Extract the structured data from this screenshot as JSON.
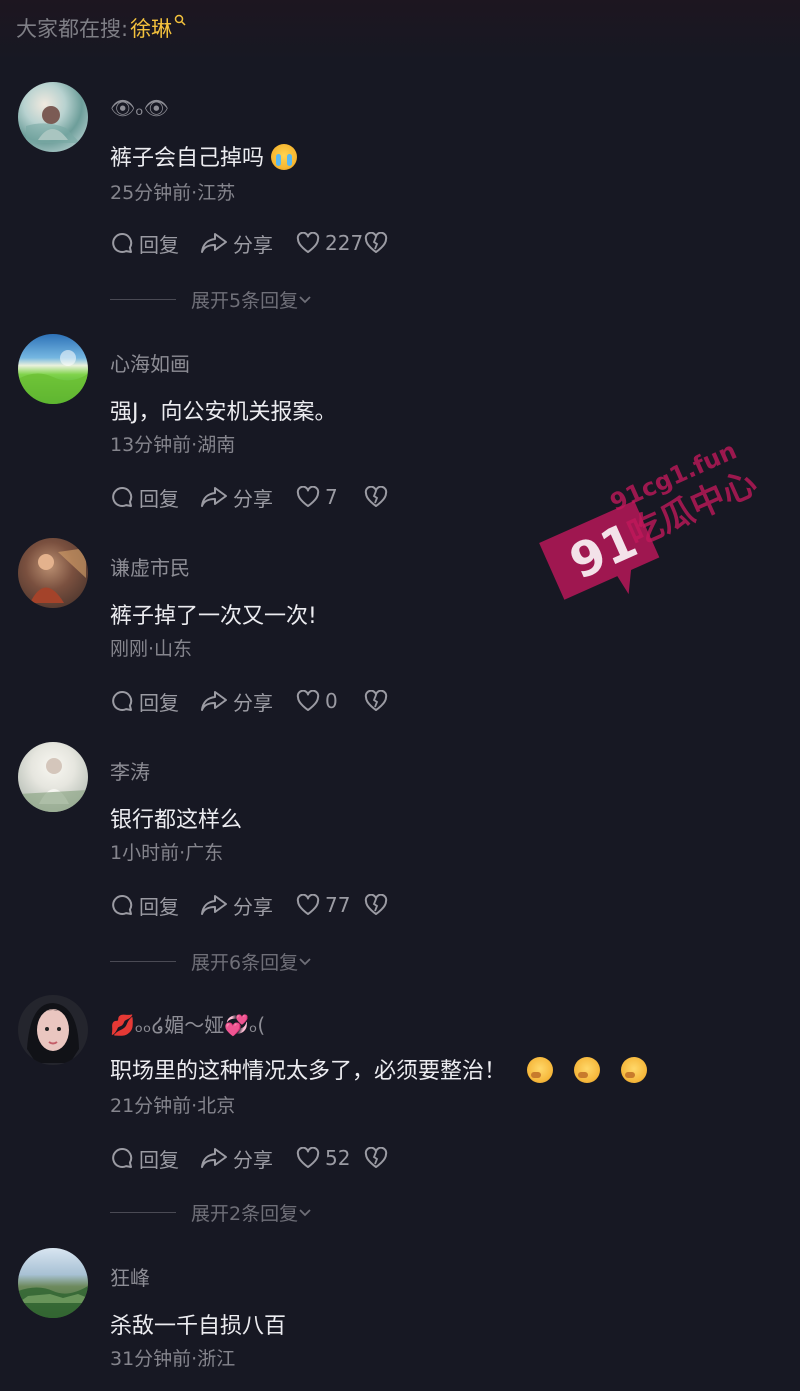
{
  "search": {
    "prefix": "大家都在搜:",
    "keyword": "徐琳"
  },
  "comments": [
    {
      "username": "👁ₒ👁",
      "text": "裤子会自己掉吗",
      "meta": "25分钟前·江苏",
      "reply": "回复",
      "share": "分享",
      "likes": "227",
      "expand": "展开5条回复"
    },
    {
      "username": "心海如画",
      "text": "强J，向公安机关报案。",
      "meta": "13分钟前·湖南",
      "reply": "回复",
      "share": "分享",
      "likes": "7"
    },
    {
      "username": "谦虚市民",
      "text": "裤子掉了一次又一次!",
      "meta": "刚刚·山东",
      "reply": "回复",
      "share": "分享",
      "likes": "0"
    },
    {
      "username": "李涛",
      "text": "银行都这样么",
      "meta": "1小时前·广东",
      "reply": "回复",
      "share": "分享",
      "likes": "77",
      "expand": "展开6条回复"
    },
    {
      "username": "💋ₒₒ໒媚～娅💞ₒ(",
      "text": "职场里的这种情况太多了，必须要整治！",
      "meta": "21分钟前·北京",
      "reply": "回复",
      "share": "分享",
      "likes": "52",
      "expand": "展开2条回复"
    },
    {
      "username": "狂峰",
      "text": "杀敌一千自损八百",
      "meta": "31分钟前·浙江"
    }
  ],
  "watermark": {
    "number": "91",
    "domain": "91cg1.fun",
    "title": "吃瓜中心"
  },
  "colors": {
    "background": "#171823",
    "accent": "#f4c23d",
    "watermark": "#c2185b"
  },
  "icons": [
    "search-icon",
    "comment-icon",
    "share-icon",
    "heart-icon",
    "broken-heart-icon",
    "chevron-down-icon",
    "crying-emoji-icon",
    "thinking-emoji-icon"
  ]
}
